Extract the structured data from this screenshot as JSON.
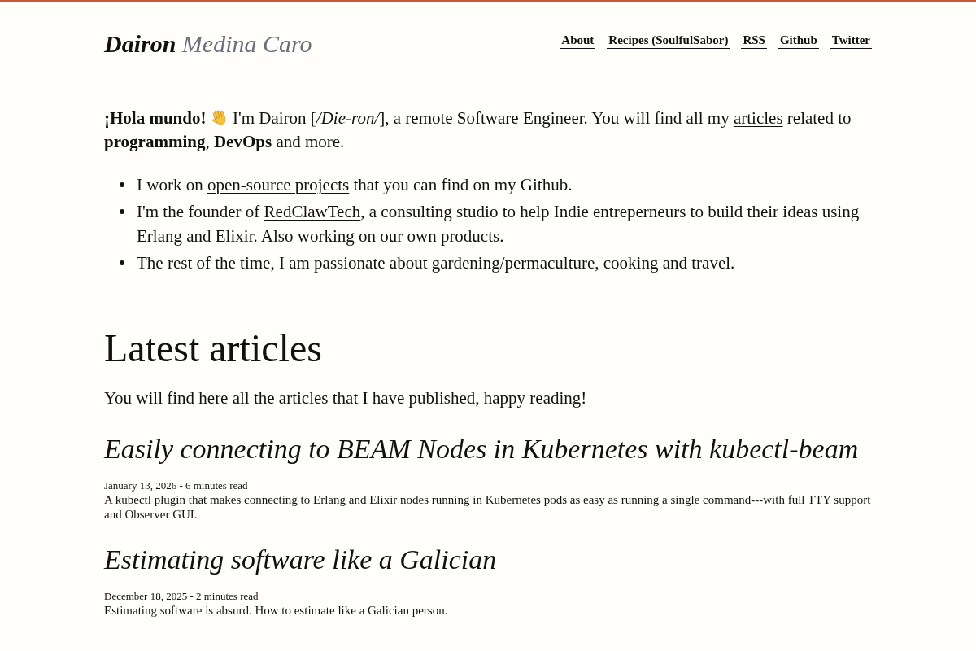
{
  "header": {
    "first_name": "Dairon",
    "last_name": "Medina Caro",
    "nav": [
      "About",
      "Recipes (SoulfulSabor)",
      "RSS",
      "Github",
      "Twitter"
    ]
  },
  "intro": [
    {
      "kind": "text",
      "text": "**¡Hola mundo!** "
    },
    {
      "kind": "wave_emoji"
    },
    {
      "kind": "text",
      "text": " I'm Dairon [*/Die-ron/*], a remote Software Engineer. You will find all my "
    },
    {
      "kind": "link",
      "text": "articles"
    },
    {
      "kind": "text",
      "text": " related to **programming**, **DevOps** and more."
    }
  ],
  "highlights": [
    [
      {
        "kind": "text",
        "text": "I work on "
      },
      {
        "kind": "link",
        "text": "open-source projects"
      },
      {
        "kind": "text",
        "text": " that you can find on my Github."
      }
    ],
    [
      {
        "kind": "text",
        "text": "I'm the founder of "
      },
      {
        "kind": "link",
        "text": "RedClawTech"
      },
      {
        "kind": "text",
        "text": ", a consulting studio to help Indie entreperneurs to build their ideas using Erlang and Elixir. Also working on our own products."
      }
    ],
    [
      {
        "kind": "text",
        "text": "The rest of the time, I am passionate about gardening/permaculture, cooking and travel."
      }
    ]
  ],
  "latest": {
    "heading": "Latest articles",
    "subtitle": "You will find here all the articles that I have published, happy reading!",
    "articles": [
      {
        "title": "Easily connecting to BEAM Nodes in Kubernetes with kubectl-beam",
        "meta": "January 13, 2026 - 6 minutes read",
        "summary": "A kubectl plugin that makes connecting to Erlang and Elixir nodes running in Kubernetes pods as easy as running a single command---with full TTY support and Observer GUI."
      },
      {
        "title": "Estimating software like a Galician",
        "meta": "December 18, 2025 - 2 minutes read",
        "summary": "Estimating software is absurd. How to estimate like a Galician person."
      }
    ]
  }
}
